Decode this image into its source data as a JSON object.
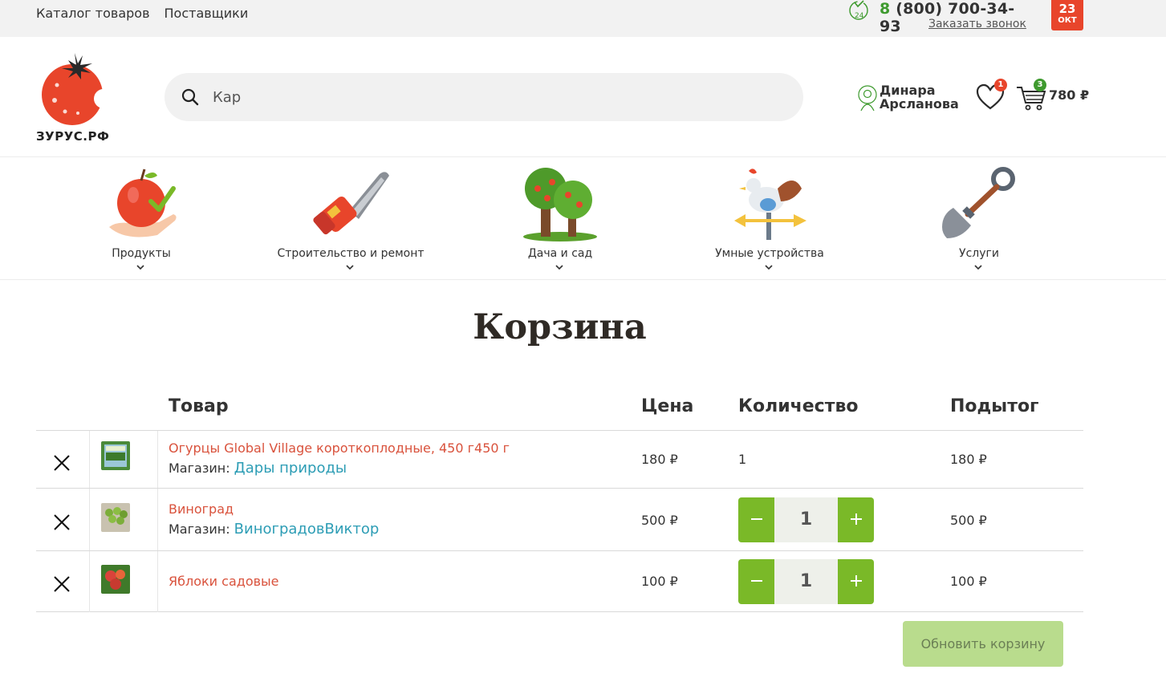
{
  "topbar": {
    "nav": [
      "Каталог товаров",
      "Поставщики"
    ],
    "phone_prefix": "8",
    "phone_rest": " (800) 700-34-93",
    "callback": "Заказать звонок",
    "date_day": "23",
    "date_month": "ОКТ"
  },
  "header": {
    "logo_text": "ЗУРУС.РФ",
    "search_value": "Кар",
    "user_name": "Динара Арсланова",
    "favorites_count": "1",
    "cart_count": "3",
    "cart_total": "780 ₽"
  },
  "categories": [
    {
      "label": "Продукты",
      "icon": "apple-hand-icon"
    },
    {
      "label": "Строительство и ремонт",
      "icon": "chainsaw-icon"
    },
    {
      "label": "Дача и сад",
      "icon": "tree-icon"
    },
    {
      "label": "Умные устройства",
      "icon": "weathervane-icon"
    },
    {
      "label": "Услуги",
      "icon": "shovel-icon"
    }
  ],
  "cart": {
    "title": "Корзина",
    "headers": {
      "product": "Товар",
      "price": "Цена",
      "quantity": "Количество",
      "subtotal": "Подытог"
    },
    "store_label": "Магазин:",
    "items": [
      {
        "name": "Огурцы Global Village короткоплодные, 450 г450 г",
        "store": "Дары природы",
        "price": "180 ₽",
        "quantity": "1",
        "subtotal": "180 ₽"
      },
      {
        "name": "Виноград",
        "store": "ВиноградовВиктор",
        "price": "500 ₽",
        "quantity": "1",
        "subtotal": "500 ₽"
      },
      {
        "name": "Яблоки садовые",
        "store": "",
        "price": "100 ₽",
        "quantity": "1",
        "subtotal": "100 ₽"
      }
    ],
    "update_button": "Обновить корзину"
  },
  "colors": {
    "accent_green": "#7ab928",
    "brand_red": "#e8452b",
    "link_red": "#d9523c",
    "link_blue": "#2d9db5"
  }
}
